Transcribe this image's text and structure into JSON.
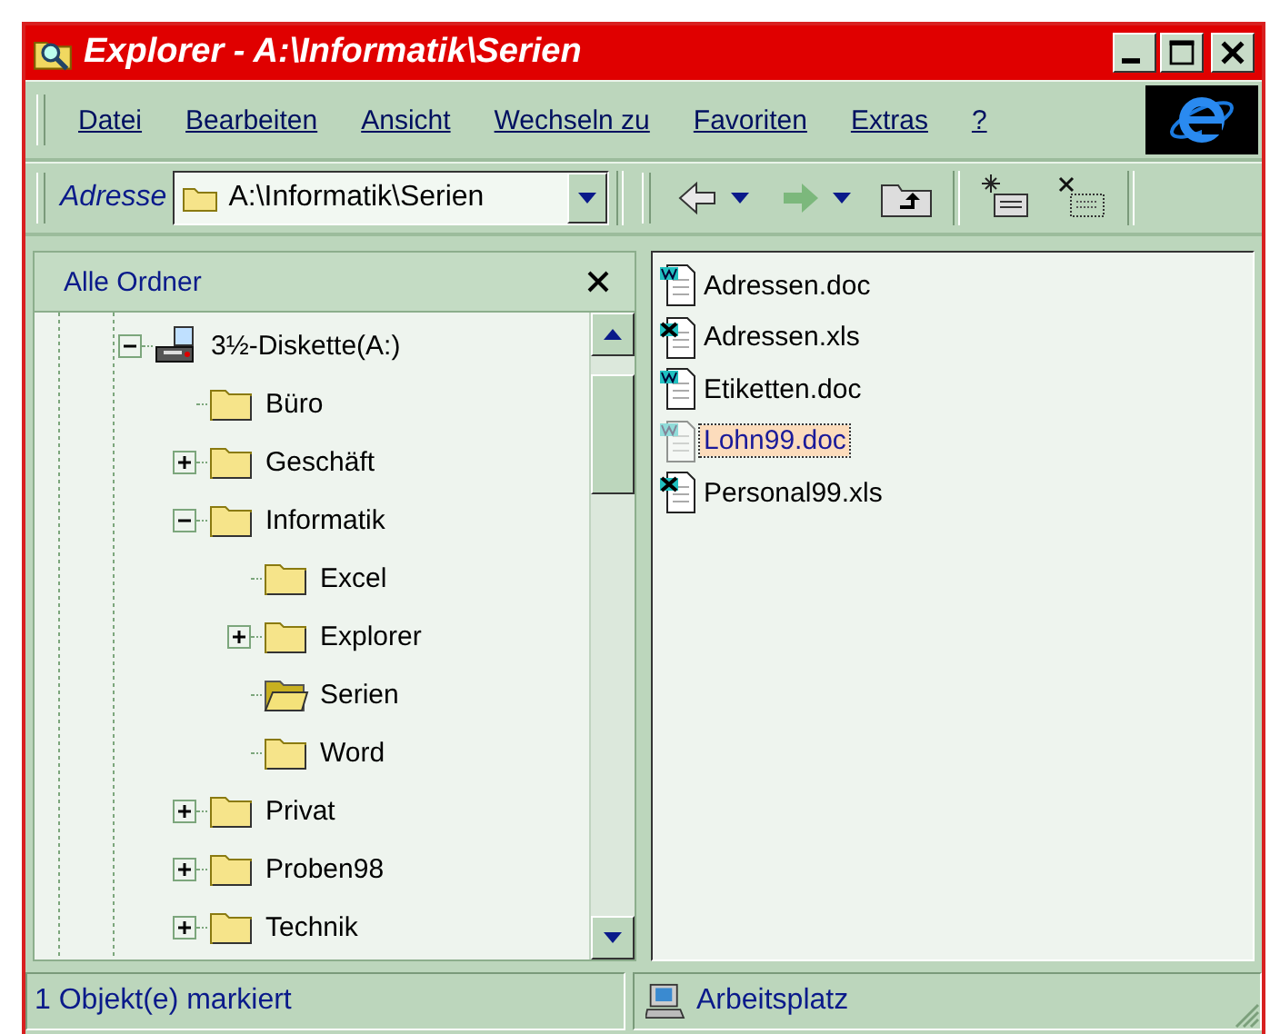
{
  "window": {
    "title": "Explorer - A:\\Informatik\\Serien"
  },
  "menu": [
    "Datei",
    "Bearbeiten",
    "Ansicht",
    "Wechseln zu",
    "Favoriten",
    "Extras",
    "?"
  ],
  "address": {
    "label": "Adresse",
    "value": "A:\\Informatik\\Serien"
  },
  "folders_pane": {
    "title": "Alle Ordner"
  },
  "tree": [
    {
      "label": "3½-Diskette(A:)",
      "kind": "drive",
      "expanded": true,
      "selected": false,
      "children": [
        {
          "label": "Büro",
          "kind": "folder",
          "selected": false
        },
        {
          "label": "Geschäft",
          "kind": "folder",
          "expanded": false,
          "selected": false
        },
        {
          "label": "Informatik",
          "kind": "folder",
          "expanded": true,
          "selected": false,
          "children": [
            {
              "label": "Excel",
              "kind": "folder",
              "selected": false
            },
            {
              "label": "Explorer",
              "kind": "folder",
              "expanded": false,
              "selected": false
            },
            {
              "label": "Serien",
              "kind": "folder",
              "selected": true
            },
            {
              "label": "Word",
              "kind": "folder",
              "selected": false
            }
          ]
        },
        {
          "label": "Privat",
          "kind": "folder",
          "expanded": false,
          "selected": false
        },
        {
          "label": "Proben98",
          "kind": "folder",
          "expanded": false,
          "selected": false
        },
        {
          "label": "Technik",
          "kind": "folder",
          "expanded": false,
          "selected": false
        }
      ]
    }
  ],
  "files": [
    {
      "name": "Adressen.doc",
      "kind": "doc",
      "selected": false
    },
    {
      "name": "Adressen.xls",
      "kind": "xls",
      "selected": false
    },
    {
      "name": "Etiketten.doc",
      "kind": "doc",
      "selected": false
    },
    {
      "name": "Lohn99.doc",
      "kind": "doc",
      "selected": true
    },
    {
      "name": "Personal99.xls",
      "kind": "xls",
      "selected": false
    }
  ],
  "status_bar": {
    "message": "1 Objekt(e) markiert",
    "zone": "Arbeitsplatz"
  }
}
